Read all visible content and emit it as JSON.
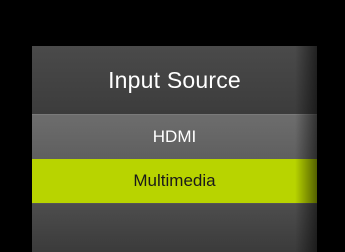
{
  "menu": {
    "title": "Input Source",
    "items": [
      {
        "label": "HDMI",
        "selected": false
      },
      {
        "label": "Multimedia",
        "selected": true
      },
      {
        "label": "",
        "selected": false
      }
    ]
  },
  "colors": {
    "background": "#000000",
    "panel": "#3f3f3f",
    "item": "#666666",
    "selected": "#b8d400"
  }
}
